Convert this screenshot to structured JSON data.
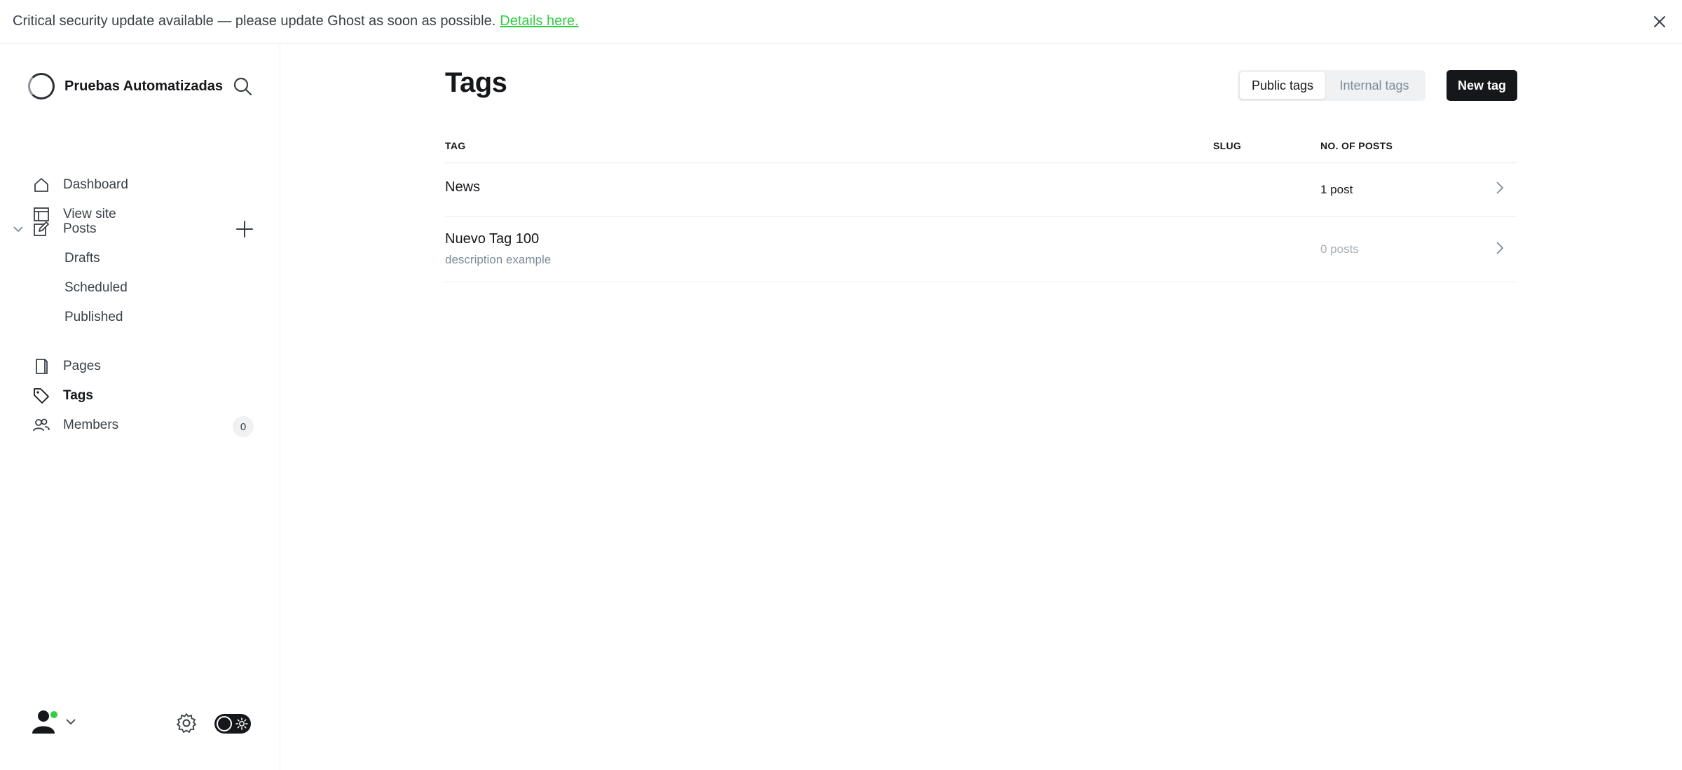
{
  "banner": {
    "message": "Critical security update available — please update Ghost as soon as possible.",
    "link_label": "Details here."
  },
  "sidebar": {
    "site_title": "Pruebas Automatizadas",
    "nav": {
      "dashboard": "Dashboard",
      "view_site": "View site",
      "posts": "Posts",
      "drafts": "Drafts",
      "scheduled": "Scheduled",
      "published": "Published",
      "pages": "Pages",
      "tags": "Tags",
      "members": "Members",
      "members_count": "0"
    }
  },
  "main": {
    "title": "Tags",
    "tabs": {
      "public": "Public tags",
      "internal": "Internal tags",
      "active": "public"
    },
    "new_button": "New tag",
    "columns": {
      "tag": "TAG",
      "slug": "SLUG",
      "posts": "NO. OF POSTS"
    },
    "rows": [
      {
        "name": "News",
        "description": "",
        "posts": "1 post"
      },
      {
        "name": "Nuevo Tag 100",
        "description": "description example",
        "posts": "0 posts"
      }
    ]
  },
  "colors": {
    "accent_green": "#30cf43",
    "primary_dark": "#15171a",
    "muted_text": "#7c8b9a"
  },
  "icons": [
    "close-icon",
    "search-icon",
    "home-icon",
    "view-site-icon",
    "chevron-down-icon",
    "edit-icon",
    "plus-icon",
    "pages-icon",
    "tag-icon",
    "members-icon",
    "user-icon",
    "gear-icon",
    "sun-icon",
    "chevron-right-icon"
  ]
}
